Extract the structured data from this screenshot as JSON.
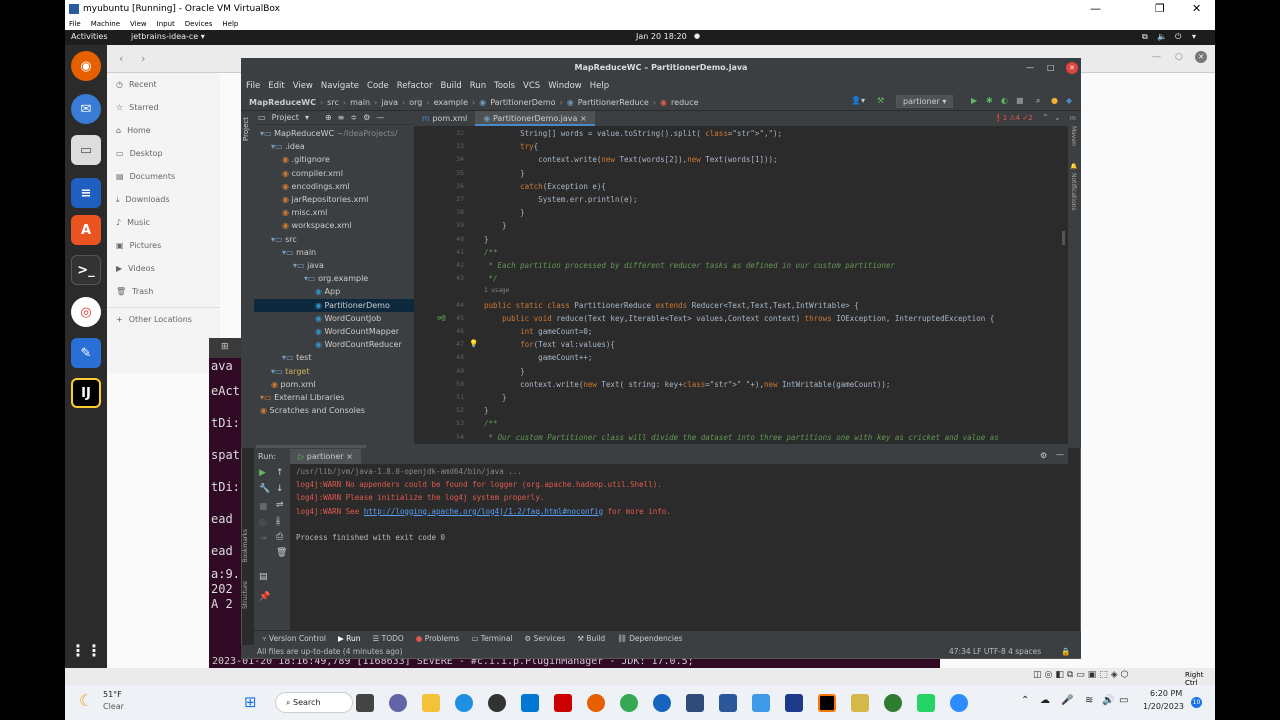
{
  "vbox": {
    "title": "myubuntu [Running] - Oracle VM VirtualBox",
    "menu": [
      "File",
      "Machine",
      "View",
      "Input",
      "Devices",
      "Help"
    ]
  },
  "ubuntu": {
    "activities": "Activities",
    "app": "jetbrains-idea-ce ▾",
    "clock": "Jan 20  18:20"
  },
  "files": {
    "sidebar": [
      "Recent",
      "Starred",
      "Home",
      "Desktop",
      "Documents",
      "Downloads",
      "Music",
      "Pictures",
      "Videos",
      "Trash",
      "Other Locations"
    ]
  },
  "terminal": {
    "lines": [
      "ava",
      "eAct",
      "tDi:",
      "spat",
      "tDi:",
      "ead",
      "ead",
      "a:9.",
      "202",
      "A 2"
    ],
    "bottom": "2023-01-20 18:16:49,789 [1168633]  SEVERE - #c.i.i.p.PluginManager - JDK: 17.0.5;"
  },
  "ide": {
    "title": "MapReduceWC – PartitionerDemo.java",
    "menu": [
      "File",
      "Edit",
      "View",
      "Navigate",
      "Code",
      "Refactor",
      "Build",
      "Run",
      "Tools",
      "VCS",
      "Window",
      "Help"
    ],
    "breadcrumb": [
      "MapReduceWC",
      "src",
      "main",
      "java",
      "org",
      "example",
      "PartitionerDemo",
      "PartitionerReduce",
      "reduce"
    ],
    "run_config": "partioner",
    "project_label": "Project",
    "tree": [
      {
        "label": "MapReduceWC",
        "hint": "~/IdeaProjects/",
        "indent": 0,
        "color": "#ccc"
      },
      {
        "label": ".idea",
        "indent": 1,
        "color": "#ccc"
      },
      {
        "label": ".gitignore",
        "indent": 2,
        "color": "#ccc"
      },
      {
        "label": "compiler.xml",
        "indent": 2,
        "color": "#ccc"
      },
      {
        "label": "encodings.xml",
        "indent": 2,
        "color": "#ccc"
      },
      {
        "label": "jarRepositories.xml",
        "indent": 2,
        "color": "#ccc"
      },
      {
        "label": "misc.xml",
        "indent": 2,
        "color": "#ccc"
      },
      {
        "label": "workspace.xml",
        "indent": 2,
        "color": "#ccc"
      },
      {
        "label": "src",
        "indent": 1,
        "color": "#ccc"
      },
      {
        "label": "main",
        "indent": 2,
        "color": "#ccc"
      },
      {
        "label": "java",
        "indent": 3,
        "color": "#ccc"
      },
      {
        "label": "org.example",
        "indent": 4,
        "color": "#ccc"
      },
      {
        "label": "App",
        "indent": 5,
        "color": "#ccc"
      },
      {
        "label": "PartitionerDemo",
        "indent": 5,
        "color": "#ccc",
        "selected": true
      },
      {
        "label": "WordCountJob",
        "indent": 5,
        "color": "#ccc"
      },
      {
        "label": "WordCountMapper",
        "indent": 5,
        "color": "#ccc"
      },
      {
        "label": "WordCountReducer",
        "indent": 5,
        "color": "#ccc"
      },
      {
        "label": "test",
        "indent": 2,
        "color": "#ccc"
      },
      {
        "label": "target",
        "indent": 1,
        "color": "#d0b060"
      },
      {
        "label": "pom.xml",
        "indent": 1,
        "color": "#ccc"
      },
      {
        "label": "External Libraries",
        "indent": 0,
        "color": "#ccc"
      },
      {
        "label": "Scratches and Consoles",
        "indent": 0,
        "color": "#ccc"
      }
    ],
    "tabs": [
      "pom.xml",
      "PartitionerDemo.java"
    ],
    "inspections": "❗1 ⚠4 ✓2",
    "code": [
      {
        "n": "32",
        "t": "        String[] words = value.toString().split( \",\");"
      },
      {
        "n": "33",
        "t": "        try{"
      },
      {
        "n": "34",
        "t": "            context.write(new Text(words[2]),new Text(words[1]));"
      },
      {
        "n": "35",
        "t": "        }"
      },
      {
        "n": "36",
        "t": "        catch(Exception e){"
      },
      {
        "n": "37",
        "t": "            System.err.println(e);"
      },
      {
        "n": "38",
        "t": "        }"
      },
      {
        "n": "39",
        "t": "    }"
      },
      {
        "n": "40",
        "t": "}"
      },
      {
        "n": "41",
        "t": "/**"
      },
      {
        "n": "42",
        "t": " * Each partition processed by different reducer tasks as defined in our custom partitioner"
      },
      {
        "n": "43",
        "t": " */"
      },
      {
        "n": "",
        "t": "1 usage"
      },
      {
        "n": "44",
        "t": "public static class PartitionerReduce extends Reducer<Text,Text,Text,IntWritable> {"
      },
      {
        "n": "45",
        "t": "    public void reduce(Text key,Iterable<Text> values,Context context) throws IOException, InterruptedException {"
      },
      {
        "n": "46",
        "t": "        int gameCount=0;"
      },
      {
        "n": "47",
        "t": "        for(Text val:values){"
      },
      {
        "n": "48",
        "t": "            gameCount++;"
      },
      {
        "n": "49",
        "t": "        }"
      },
      {
        "n": "50",
        "t": "        context.write(new Text( string: key+\" \"+),new IntWritable(gameCount));"
      },
      {
        "n": "51",
        "t": "    }"
      },
      {
        "n": "52",
        "t": "}"
      },
      {
        "n": "53",
        "t": "/**"
      },
      {
        "n": "54",
        "t": " * Our custom Partitioner class will divide the dataset into three partitions one with key as cricket and value as"
      }
    ],
    "run_label": "Run:",
    "run_tab": "partioner",
    "console": [
      {
        "t": "/usr/lib/jvm/java-1.8.0-openjdk-amd64/bin/java ...",
        "c": "#888"
      },
      {
        "t": "log4j:WARN No appenders could be found for logger (org.apache.hadoop.util.Shell).",
        "c": "#e05a4f"
      },
      {
        "t": "log4j:WARN Please initialize the log4j system properly.",
        "c": "#e05a4f"
      },
      {
        "t": "log4j:WARN See http://logging.apache.org/log4j/1.2/faq.html#noconfig for more info.",
        "c": "#e05a4f"
      },
      {
        "t": "",
        "c": "#ccc"
      },
      {
        "t": "Process finished with exit code 0",
        "c": "#bbb"
      }
    ],
    "bottom_tabs": [
      "Version Control",
      "Run",
      "TODO",
      "Problems",
      "Terminal",
      "Services",
      "Build",
      "Dependencies"
    ],
    "status_left": "All files are up-to-date (4 minutes ago)",
    "status_right": "47:34  LF  UTF-8  4 spaces"
  },
  "taskbar": {
    "weather_temp": "51°F",
    "weather_desc": "Clear",
    "search": "Search",
    "time": "6:20 PM",
    "date": "1/20/2023",
    "right_ctrl": "Right Ctrl",
    "badge": "10"
  }
}
